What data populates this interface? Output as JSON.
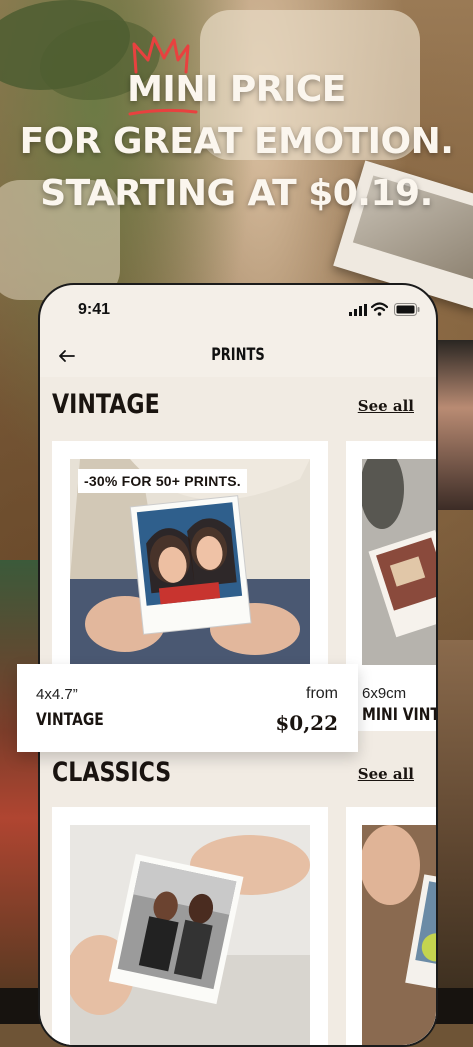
{
  "headline": {
    "line1": "MINI PRICE",
    "line2": "FOR GREAT EMOTION.",
    "line3": "STARTING AT $0.19."
  },
  "status_bar": {
    "time": "9:41"
  },
  "nav": {
    "title": "PRINTS",
    "back_icon": "arrow-left-icon"
  },
  "sections": [
    {
      "title": "VINTAGE",
      "see_all": "See all",
      "cards": [
        {
          "badge": "-30% FOR 50+ PRINTS.",
          "size": "4x4.7”",
          "name": "VINTAGE",
          "from_label": "from",
          "price": "$0,22"
        },
        {
          "size": "6x9cm",
          "name": "MINI VINTAGE"
        }
      ]
    },
    {
      "title": "CLASSICS",
      "see_all": "See all"
    }
  ],
  "colors": {
    "cream": "#f1ebe3",
    "text": "#1a1410",
    "headline": "#fbf6ee",
    "crown": "#e8413f"
  }
}
